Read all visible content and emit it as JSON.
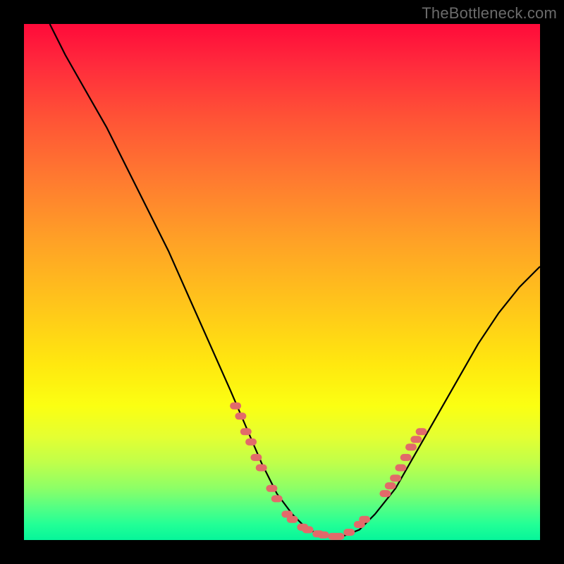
{
  "watermark": "TheBottleneck.com",
  "colors": {
    "curve_stroke": "#000000",
    "marker_fill": "#e26a6a",
    "frame_bg": "#000000"
  },
  "chart_data": {
    "type": "line",
    "title": "",
    "xlabel": "",
    "ylabel": "",
    "xlim": [
      0,
      100
    ],
    "ylim": [
      0,
      100
    ],
    "series": [
      {
        "name": "curve",
        "x": [
          5,
          8,
          12,
          16,
          20,
          24,
          28,
          32,
          36,
          40,
          43,
          46,
          49,
          52,
          55,
          58,
          60,
          62,
          65,
          68,
          72,
          76,
          80,
          84,
          88,
          92,
          96,
          100
        ],
        "y": [
          100,
          94,
          87,
          80,
          72,
          64,
          56,
          47,
          38,
          29,
          22,
          15,
          9,
          5,
          2,
          1,
          0.5,
          0.8,
          2,
          5,
          10,
          17,
          24,
          31,
          38,
          44,
          49,
          53
        ]
      }
    ],
    "markers": [
      {
        "x": 41,
        "y": 26
      },
      {
        "x": 42,
        "y": 24
      },
      {
        "x": 43,
        "y": 21
      },
      {
        "x": 44,
        "y": 19
      },
      {
        "x": 45,
        "y": 16
      },
      {
        "x": 46,
        "y": 14
      },
      {
        "x": 48,
        "y": 10
      },
      {
        "x": 49,
        "y": 8
      },
      {
        "x": 51,
        "y": 5
      },
      {
        "x": 52,
        "y": 4
      },
      {
        "x": 54,
        "y": 2.5
      },
      {
        "x": 55,
        "y": 2
      },
      {
        "x": 57,
        "y": 1.2
      },
      {
        "x": 58,
        "y": 1
      },
      {
        "x": 60,
        "y": 0.7
      },
      {
        "x": 61,
        "y": 0.7
      },
      {
        "x": 63,
        "y": 1.5
      },
      {
        "x": 65,
        "y": 3
      },
      {
        "x": 66,
        "y": 4
      },
      {
        "x": 70,
        "y": 9
      },
      {
        "x": 71,
        "y": 10.5
      },
      {
        "x": 72,
        "y": 12
      },
      {
        "x": 73,
        "y": 14
      },
      {
        "x": 74,
        "y": 16
      },
      {
        "x": 75,
        "y": 18
      },
      {
        "x": 76,
        "y": 19.5
      },
      {
        "x": 77,
        "y": 21
      }
    ]
  }
}
